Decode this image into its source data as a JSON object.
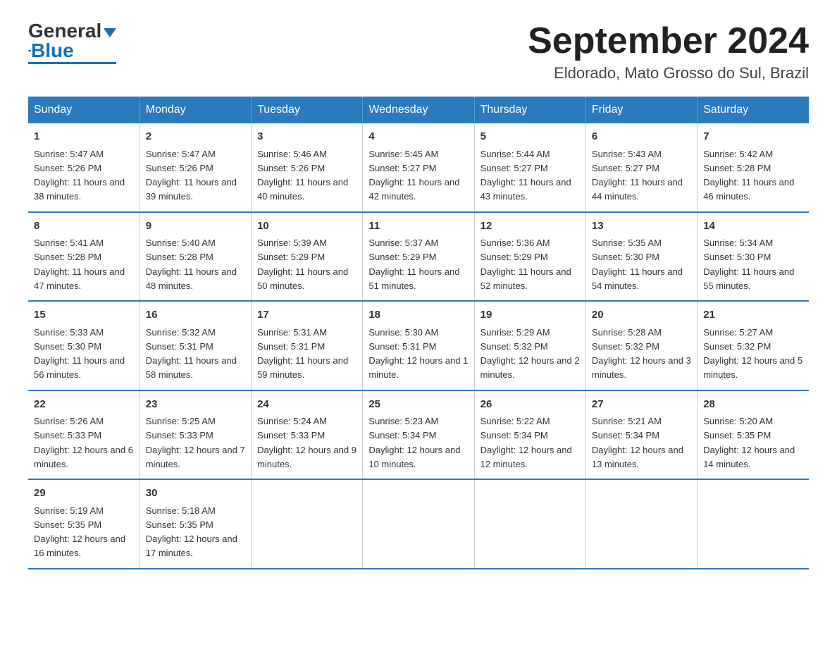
{
  "logo": {
    "text_general": "General",
    "text_blue": "Blue"
  },
  "header": {
    "month_year": "September 2024",
    "location": "Eldorado, Mato Grosso do Sul, Brazil"
  },
  "weekdays": [
    "Sunday",
    "Monday",
    "Tuesday",
    "Wednesday",
    "Thursday",
    "Friday",
    "Saturday"
  ],
  "weeks": [
    [
      {
        "day": "1",
        "sunrise": "5:47 AM",
        "sunset": "5:26 PM",
        "daylight": "11 hours and 38 minutes."
      },
      {
        "day": "2",
        "sunrise": "5:47 AM",
        "sunset": "5:26 PM",
        "daylight": "11 hours and 39 minutes."
      },
      {
        "day": "3",
        "sunrise": "5:46 AM",
        "sunset": "5:26 PM",
        "daylight": "11 hours and 40 minutes."
      },
      {
        "day": "4",
        "sunrise": "5:45 AM",
        "sunset": "5:27 PM",
        "daylight": "11 hours and 42 minutes."
      },
      {
        "day": "5",
        "sunrise": "5:44 AM",
        "sunset": "5:27 PM",
        "daylight": "11 hours and 43 minutes."
      },
      {
        "day": "6",
        "sunrise": "5:43 AM",
        "sunset": "5:27 PM",
        "daylight": "11 hours and 44 minutes."
      },
      {
        "day": "7",
        "sunrise": "5:42 AM",
        "sunset": "5:28 PM",
        "daylight": "11 hours and 46 minutes."
      }
    ],
    [
      {
        "day": "8",
        "sunrise": "5:41 AM",
        "sunset": "5:28 PM",
        "daylight": "11 hours and 47 minutes."
      },
      {
        "day": "9",
        "sunrise": "5:40 AM",
        "sunset": "5:28 PM",
        "daylight": "11 hours and 48 minutes."
      },
      {
        "day": "10",
        "sunrise": "5:39 AM",
        "sunset": "5:29 PM",
        "daylight": "11 hours and 50 minutes."
      },
      {
        "day": "11",
        "sunrise": "5:37 AM",
        "sunset": "5:29 PM",
        "daylight": "11 hours and 51 minutes."
      },
      {
        "day": "12",
        "sunrise": "5:36 AM",
        "sunset": "5:29 PM",
        "daylight": "11 hours and 52 minutes."
      },
      {
        "day": "13",
        "sunrise": "5:35 AM",
        "sunset": "5:30 PM",
        "daylight": "11 hours and 54 minutes."
      },
      {
        "day": "14",
        "sunrise": "5:34 AM",
        "sunset": "5:30 PM",
        "daylight": "11 hours and 55 minutes."
      }
    ],
    [
      {
        "day": "15",
        "sunrise": "5:33 AM",
        "sunset": "5:30 PM",
        "daylight": "11 hours and 56 minutes."
      },
      {
        "day": "16",
        "sunrise": "5:32 AM",
        "sunset": "5:31 PM",
        "daylight": "11 hours and 58 minutes."
      },
      {
        "day": "17",
        "sunrise": "5:31 AM",
        "sunset": "5:31 PM",
        "daylight": "11 hours and 59 minutes."
      },
      {
        "day": "18",
        "sunrise": "5:30 AM",
        "sunset": "5:31 PM",
        "daylight": "12 hours and 1 minute."
      },
      {
        "day": "19",
        "sunrise": "5:29 AM",
        "sunset": "5:32 PM",
        "daylight": "12 hours and 2 minutes."
      },
      {
        "day": "20",
        "sunrise": "5:28 AM",
        "sunset": "5:32 PM",
        "daylight": "12 hours and 3 minutes."
      },
      {
        "day": "21",
        "sunrise": "5:27 AM",
        "sunset": "5:32 PM",
        "daylight": "12 hours and 5 minutes."
      }
    ],
    [
      {
        "day": "22",
        "sunrise": "5:26 AM",
        "sunset": "5:33 PM",
        "daylight": "12 hours and 6 minutes."
      },
      {
        "day": "23",
        "sunrise": "5:25 AM",
        "sunset": "5:33 PM",
        "daylight": "12 hours and 7 minutes."
      },
      {
        "day": "24",
        "sunrise": "5:24 AM",
        "sunset": "5:33 PM",
        "daylight": "12 hours and 9 minutes."
      },
      {
        "day": "25",
        "sunrise": "5:23 AM",
        "sunset": "5:34 PM",
        "daylight": "12 hours and 10 minutes."
      },
      {
        "day": "26",
        "sunrise": "5:22 AM",
        "sunset": "5:34 PM",
        "daylight": "12 hours and 12 minutes."
      },
      {
        "day": "27",
        "sunrise": "5:21 AM",
        "sunset": "5:34 PM",
        "daylight": "12 hours and 13 minutes."
      },
      {
        "day": "28",
        "sunrise": "5:20 AM",
        "sunset": "5:35 PM",
        "daylight": "12 hours and 14 minutes."
      }
    ],
    [
      {
        "day": "29",
        "sunrise": "5:19 AM",
        "sunset": "5:35 PM",
        "daylight": "12 hours and 16 minutes."
      },
      {
        "day": "30",
        "sunrise": "5:18 AM",
        "sunset": "5:35 PM",
        "daylight": "12 hours and 17 minutes."
      },
      null,
      null,
      null,
      null,
      null
    ]
  ]
}
